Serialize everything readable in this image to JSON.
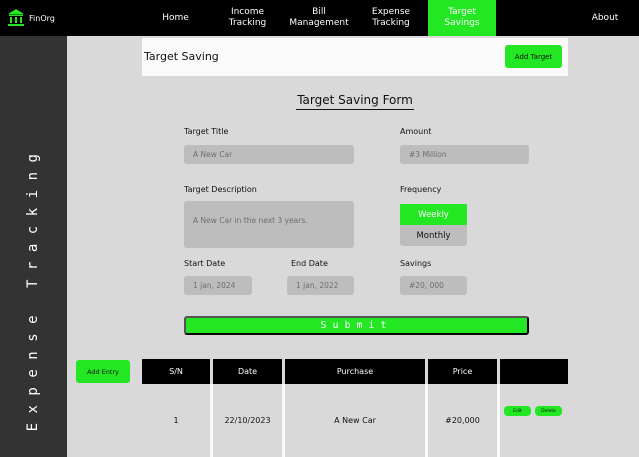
{
  "brand": {
    "name": "FinOrg",
    "icon": "bank-icon"
  },
  "nav": [
    {
      "label": "Home",
      "active": false
    },
    {
      "label": "Income Tracking",
      "active": false
    },
    {
      "label": "Bill Management",
      "active": false
    },
    {
      "label": "Expense Tracking",
      "active": false
    },
    {
      "label": "Target Savings",
      "active": true
    },
    {
      "label": "About",
      "active": false
    }
  ],
  "sidebar": {
    "title": "Expense Tracking"
  },
  "header": {
    "title": "Target Saving",
    "add_target_label": "Add Target"
  },
  "form": {
    "title": "Target Saving Form",
    "target_title_label": "Target Title",
    "target_title_placeholder": "A New Car",
    "amount_label": "Amount",
    "amount_placeholder": "#3 Million",
    "description_label": "Target Description",
    "description_placeholder": "A New Car in the next 3 years.",
    "frequency_label": "Frequency",
    "frequency_options": [
      "Weekly",
      "Monthly"
    ],
    "frequency_selected": "Weekly",
    "start_date_label": "Start Date",
    "start_date_placeholder": "1 jan, 2024",
    "end_date_label": "End Date",
    "end_date_placeholder": "1 jan, 2022",
    "savings_label": "Savings",
    "savings_placeholder": "#20, 000",
    "submit_label": "Submit"
  },
  "add_entry_label": "Add Entry",
  "table": {
    "headers": [
      "S/N",
      "Date",
      "Purchase",
      "Price",
      ""
    ],
    "rows": [
      {
        "sn": "1",
        "date": "22/10/2023",
        "purchase": "A New Car",
        "price": "#20,000",
        "edit_label": "Edit",
        "delete_label": "Delete"
      }
    ]
  },
  "colors": {
    "accent": "#22e722",
    "nav_bg": "#000000",
    "sidebar_bg": "#333333",
    "panel_bg": "#d9d9d9"
  }
}
